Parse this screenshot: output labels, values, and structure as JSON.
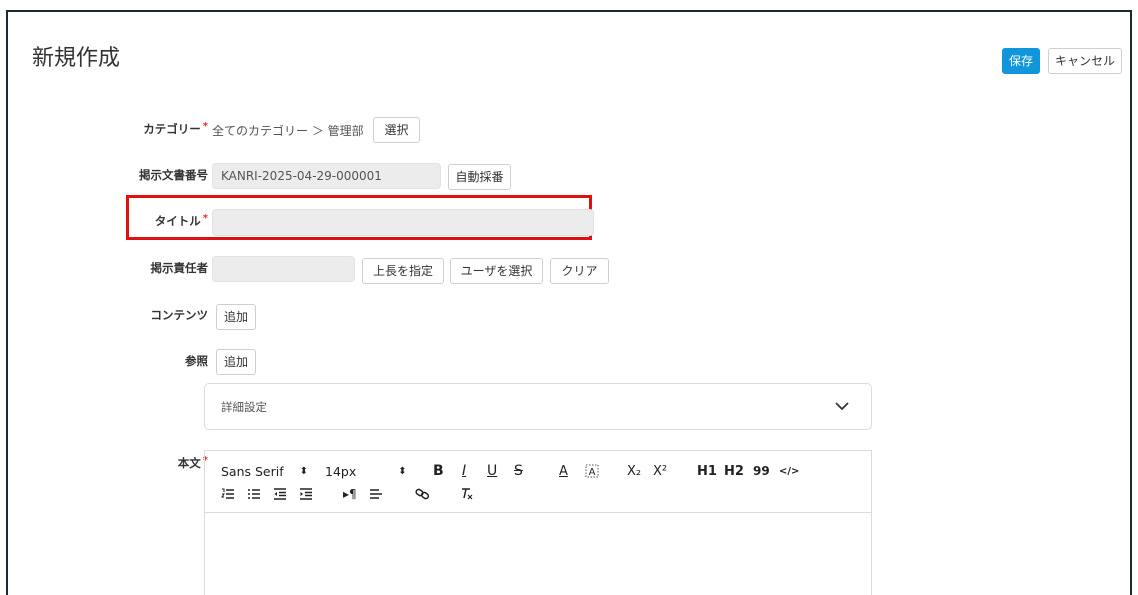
{
  "page": {
    "title": "新規作成"
  },
  "header": {
    "save_label": "保存",
    "cancel_label": "キャンセル"
  },
  "form": {
    "category": {
      "label": "カテゴリー",
      "value": "全てのカテゴリー ＞ 管理部",
      "button": "選択"
    },
    "doc_number": {
      "label": "掲示文書番号",
      "value": "KANRI-2025-04-29-000001",
      "button": "自動採番"
    },
    "title": {
      "label": "タイトル",
      "value": ""
    },
    "owner": {
      "label": "掲示責任者",
      "value": "",
      "btn_superior": "上長を指定",
      "btn_user": "ユーザを選択",
      "btn_clear": "クリア"
    },
    "contents": {
      "label": "コンテンツ",
      "button": "追加"
    },
    "reference": {
      "label": "参照",
      "button": "追加"
    },
    "required_mark": "*"
  },
  "accordion": {
    "label": "詳細設定"
  },
  "editor": {
    "label": "本文",
    "font": "Sans Serif",
    "size": "14px",
    "h1": "H1",
    "h2": "H2",
    "quote": "99",
    "code": "</>",
    "sub": "X₂",
    "sup": "X²"
  }
}
